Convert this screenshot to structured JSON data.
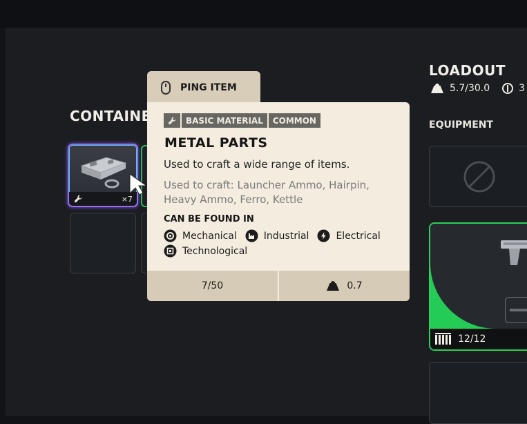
{
  "left_panel": {
    "title": "CONTAINERS",
    "slot_item": {
      "quantity": "×7",
      "icon": "wrench-icon",
      "rarity_colors": [
        "#9a6cf0",
        "#3bd6e6"
      ]
    }
  },
  "ping": {
    "label": "PING ITEM",
    "icon": "mouse-icon"
  },
  "tooltip": {
    "tags": [
      "BASIC MATERIAL",
      "COMMON"
    ],
    "name": "METAL PARTS",
    "description": "Used to craft a wide range of items.",
    "used_to_craft_line1": "Used to craft: Launcher Ammo, Hairpin,",
    "used_to_craft_line2": "Heavy Ammo, Ferro, Kettle",
    "found_in_title": "CAN BE FOUND IN",
    "locations": [
      {
        "label": "Mechanical",
        "icon": "gear-icon"
      },
      {
        "label": "Industrial",
        "icon": "factory-icon"
      },
      {
        "label": "Electrical",
        "icon": "bolt-icon"
      },
      {
        "label": "Technological",
        "icon": "chip-icon"
      }
    ],
    "stack": "7/50",
    "weight": "0.7",
    "colors": {
      "background": "#f3ecdf",
      "footer": "#d6cbb6",
      "tag": "#676661"
    }
  },
  "loadout": {
    "title": "LOADOUT",
    "weight": "5.7/30.0",
    "second_stat": "3",
    "equipment_title": "EQUIPMENT",
    "weapon_ammo": "12/12",
    "accent_color": "#2ad15a"
  }
}
